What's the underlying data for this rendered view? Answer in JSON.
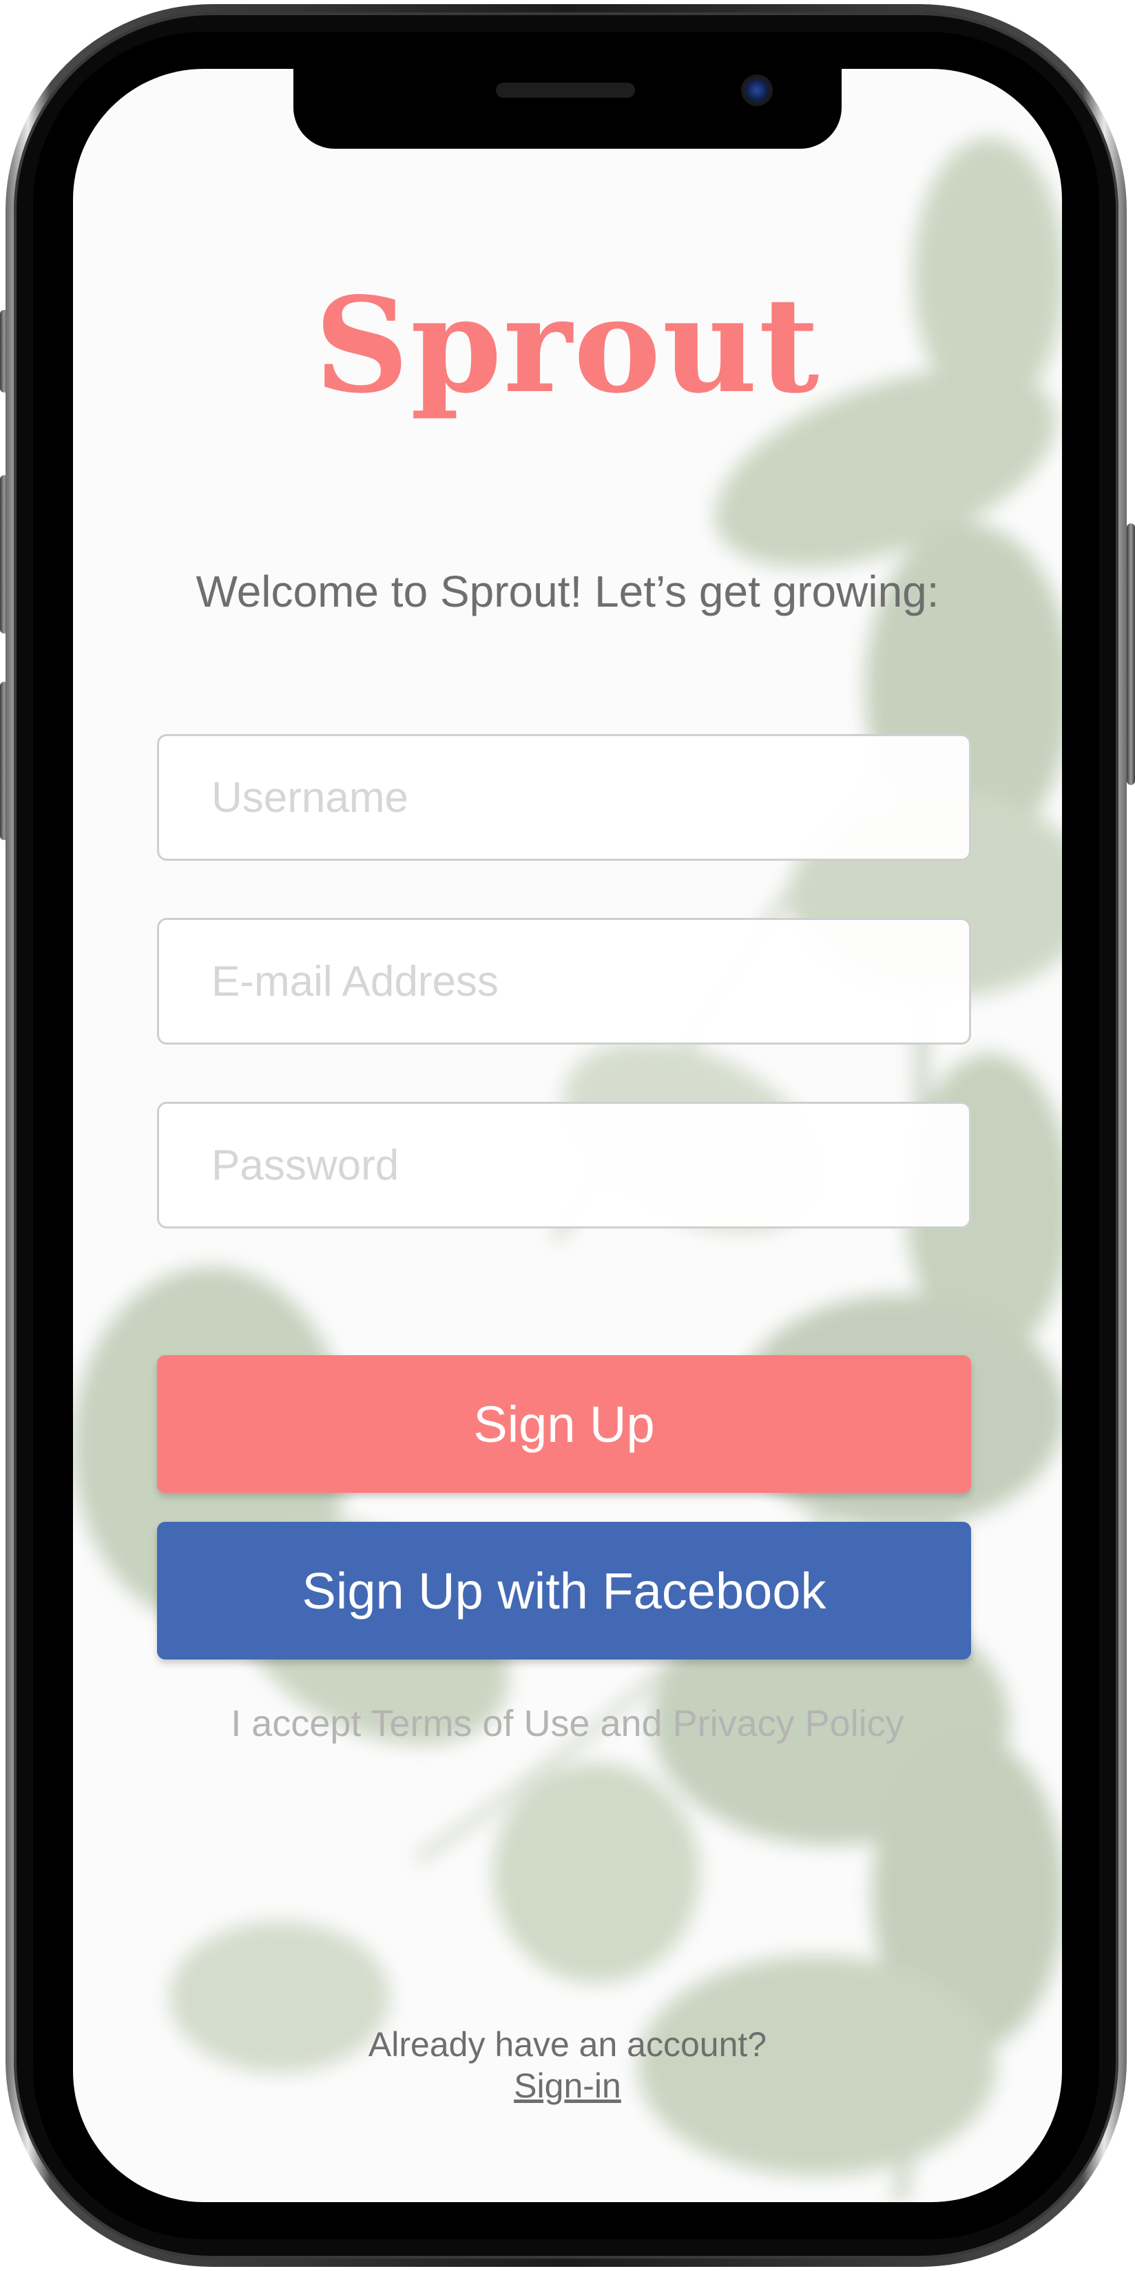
{
  "app": {
    "logo": "Sprout",
    "welcome": "Welcome to Sprout! Let’s get growing:"
  },
  "form": {
    "username": {
      "placeholder": "Username",
      "value": ""
    },
    "email": {
      "placeholder": "E-mail Address",
      "value": ""
    },
    "password": {
      "placeholder": "Password",
      "value": ""
    }
  },
  "buttons": {
    "signup_label": "Sign Up",
    "facebook_label": "Sign Up with Facebook"
  },
  "legal": {
    "terms": "I accept Terms of Use and Privacy Policy"
  },
  "footer": {
    "already": "Already have an account?",
    "signin": "Sign-in"
  },
  "colors": {
    "brand": "#fa7e7e",
    "facebook": "#4369b4",
    "text_muted": "#6e6e6e",
    "background": "#fbfbfb"
  }
}
